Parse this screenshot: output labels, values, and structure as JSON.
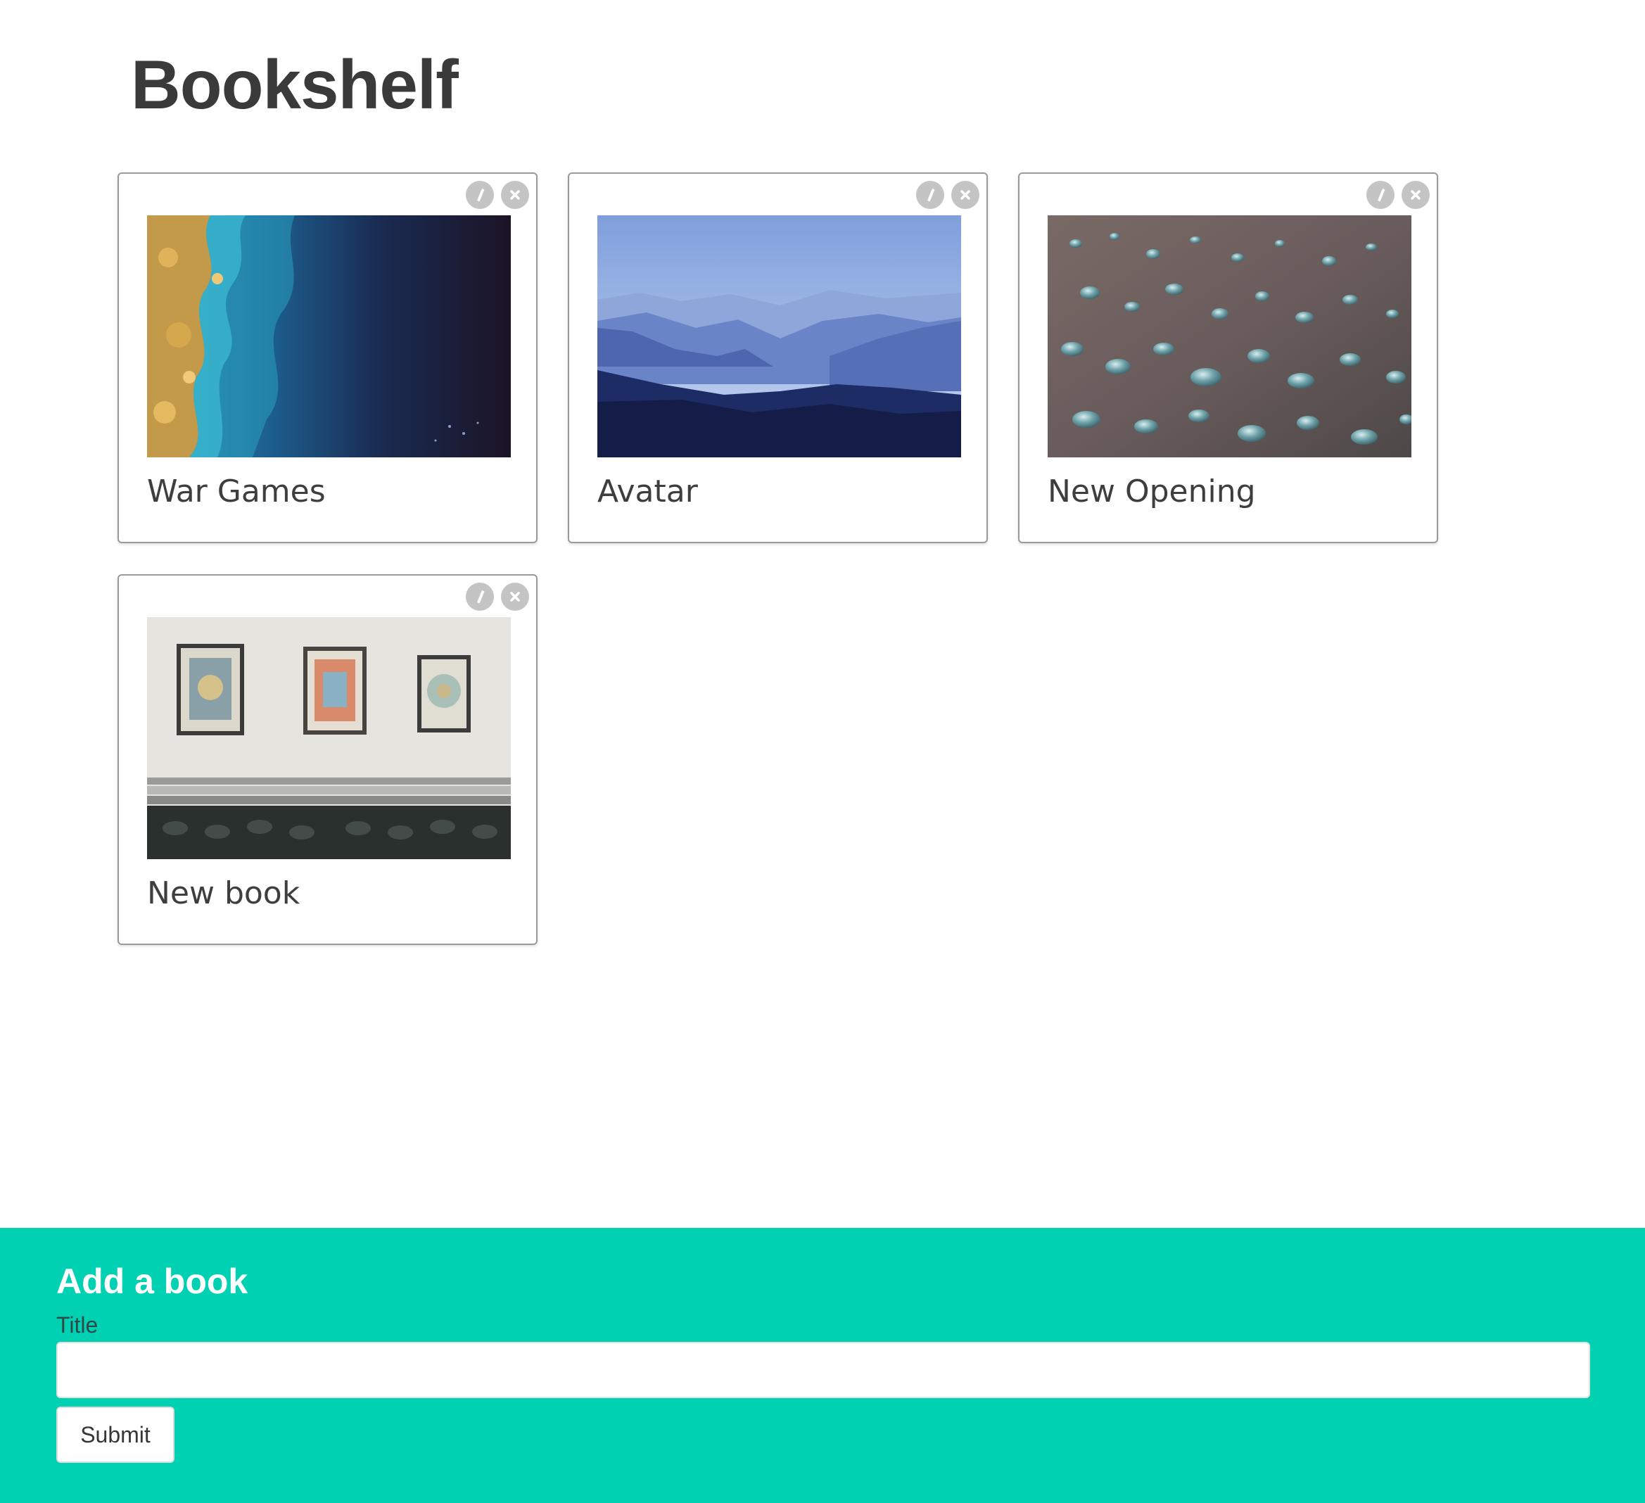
{
  "page": {
    "title": "Bookshelf"
  },
  "books": [
    {
      "title": "War Games",
      "cover_icon": "satellite-coast-image"
    },
    {
      "title": "Avatar",
      "cover_icon": "misty-mountains-image"
    },
    {
      "title": "New Opening",
      "cover_icon": "water-drops-image"
    },
    {
      "title": "New book",
      "cover_icon": "framed-pictures-room-image"
    }
  ],
  "card_actions": {
    "edit_icon": "pencil-icon",
    "delete_icon": "close-icon"
  },
  "add_form": {
    "heading": "Add a book",
    "title_label": "Title",
    "title_value": "",
    "title_placeholder": "",
    "submit_label": "Submit"
  },
  "colors": {
    "panel_background": "#00d1b2",
    "title_text": "#3a3a3a",
    "action_icon": "#c4c4c4"
  }
}
